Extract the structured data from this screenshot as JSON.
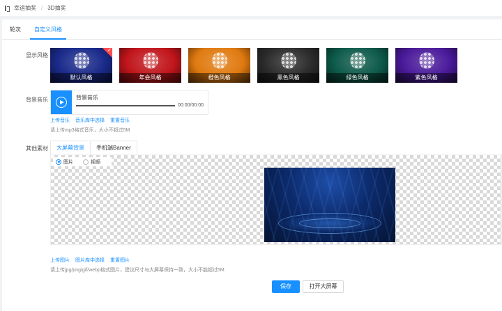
{
  "breadcrumb": {
    "icon": "lottery-icon",
    "items": [
      "幸运抽奖",
      "3D抽奖"
    ],
    "separator": "/"
  },
  "tabs": [
    {
      "label": "轮次",
      "active": false
    },
    {
      "label": "自定义风格",
      "active": true
    }
  ],
  "display_style": {
    "label": "显示风格",
    "items": [
      {
        "caption": "默认风格",
        "color": "#1a2a8a",
        "selected": true
      },
      {
        "caption": "年会风格",
        "color": "#c0151b",
        "selected": false
      },
      {
        "caption": "橙色风格",
        "color": "#e07a10",
        "selected": false
      },
      {
        "caption": "黑色风格",
        "color": "#2b2b2b",
        "selected": false
      },
      {
        "caption": "绿色风格",
        "color": "#0d5a4a",
        "selected": false
      },
      {
        "caption": "紫色风格",
        "color": "#4a1a9a",
        "selected": false
      }
    ]
  },
  "background_music": {
    "label": "背景音乐",
    "title": "背景音乐",
    "time": "00:00/00:00",
    "links": [
      "上传音乐",
      "音乐库中选择",
      "重置音乐"
    ],
    "hint": "请上传mp3格式音乐，大小不超过5M"
  },
  "other_materials": {
    "label": "其他素材",
    "tabs": [
      {
        "label": "大屏幕背景",
        "active": true
      },
      {
        "label": "手机端Banner",
        "active": false
      }
    ],
    "radios": [
      {
        "label": "图片",
        "checked": true
      },
      {
        "label": "视频",
        "checked": false
      }
    ],
    "links": [
      "上传图片",
      "图片库中选择",
      "重置图片"
    ],
    "hint": "请上传jpg/png/gif/webp格式图片，建议尺寸与大屏幕保持一致，大小不能超过5M"
  },
  "actions": {
    "save": "保存",
    "open_screen": "打开大屏幕"
  }
}
